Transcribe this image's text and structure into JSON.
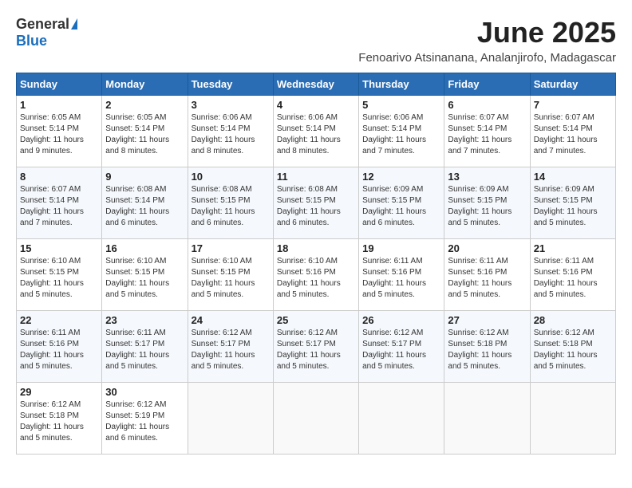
{
  "logo": {
    "general": "General",
    "blue": "Blue"
  },
  "title": "June 2025",
  "location": "Fenoarivo Atsinanana, Analanjirofo, Madagascar",
  "days_of_week": [
    "Sunday",
    "Monday",
    "Tuesday",
    "Wednesday",
    "Thursday",
    "Friday",
    "Saturday"
  ],
  "weeks": [
    [
      {
        "day": "1",
        "sunrise": "6:05 AM",
        "sunset": "5:14 PM",
        "daylight": "11 hours and 9 minutes."
      },
      {
        "day": "2",
        "sunrise": "6:05 AM",
        "sunset": "5:14 PM",
        "daylight": "11 hours and 8 minutes."
      },
      {
        "day": "3",
        "sunrise": "6:06 AM",
        "sunset": "5:14 PM",
        "daylight": "11 hours and 8 minutes."
      },
      {
        "day": "4",
        "sunrise": "6:06 AM",
        "sunset": "5:14 PM",
        "daylight": "11 hours and 8 minutes."
      },
      {
        "day": "5",
        "sunrise": "6:06 AM",
        "sunset": "5:14 PM",
        "daylight": "11 hours and 7 minutes."
      },
      {
        "day": "6",
        "sunrise": "6:07 AM",
        "sunset": "5:14 PM",
        "daylight": "11 hours and 7 minutes."
      },
      {
        "day": "7",
        "sunrise": "6:07 AM",
        "sunset": "5:14 PM",
        "daylight": "11 hours and 7 minutes."
      }
    ],
    [
      {
        "day": "8",
        "sunrise": "6:07 AM",
        "sunset": "5:14 PM",
        "daylight": "11 hours and 7 minutes."
      },
      {
        "day": "9",
        "sunrise": "6:08 AM",
        "sunset": "5:14 PM",
        "daylight": "11 hours and 6 minutes."
      },
      {
        "day": "10",
        "sunrise": "6:08 AM",
        "sunset": "5:15 PM",
        "daylight": "11 hours and 6 minutes."
      },
      {
        "day": "11",
        "sunrise": "6:08 AM",
        "sunset": "5:15 PM",
        "daylight": "11 hours and 6 minutes."
      },
      {
        "day": "12",
        "sunrise": "6:09 AM",
        "sunset": "5:15 PM",
        "daylight": "11 hours and 6 minutes."
      },
      {
        "day": "13",
        "sunrise": "6:09 AM",
        "sunset": "5:15 PM",
        "daylight": "11 hours and 5 minutes."
      },
      {
        "day": "14",
        "sunrise": "6:09 AM",
        "sunset": "5:15 PM",
        "daylight": "11 hours and 5 minutes."
      }
    ],
    [
      {
        "day": "15",
        "sunrise": "6:10 AM",
        "sunset": "5:15 PM",
        "daylight": "11 hours and 5 minutes."
      },
      {
        "day": "16",
        "sunrise": "6:10 AM",
        "sunset": "5:15 PM",
        "daylight": "11 hours and 5 minutes."
      },
      {
        "day": "17",
        "sunrise": "6:10 AM",
        "sunset": "5:15 PM",
        "daylight": "11 hours and 5 minutes."
      },
      {
        "day": "18",
        "sunrise": "6:10 AM",
        "sunset": "5:16 PM",
        "daylight": "11 hours and 5 minutes."
      },
      {
        "day": "19",
        "sunrise": "6:11 AM",
        "sunset": "5:16 PM",
        "daylight": "11 hours and 5 minutes."
      },
      {
        "day": "20",
        "sunrise": "6:11 AM",
        "sunset": "5:16 PM",
        "daylight": "11 hours and 5 minutes."
      },
      {
        "day": "21",
        "sunrise": "6:11 AM",
        "sunset": "5:16 PM",
        "daylight": "11 hours and 5 minutes."
      }
    ],
    [
      {
        "day": "22",
        "sunrise": "6:11 AM",
        "sunset": "5:16 PM",
        "daylight": "11 hours and 5 minutes."
      },
      {
        "day": "23",
        "sunrise": "6:11 AM",
        "sunset": "5:17 PM",
        "daylight": "11 hours and 5 minutes."
      },
      {
        "day": "24",
        "sunrise": "6:12 AM",
        "sunset": "5:17 PM",
        "daylight": "11 hours and 5 minutes."
      },
      {
        "day": "25",
        "sunrise": "6:12 AM",
        "sunset": "5:17 PM",
        "daylight": "11 hours and 5 minutes."
      },
      {
        "day": "26",
        "sunrise": "6:12 AM",
        "sunset": "5:17 PM",
        "daylight": "11 hours and 5 minutes."
      },
      {
        "day": "27",
        "sunrise": "6:12 AM",
        "sunset": "5:18 PM",
        "daylight": "11 hours and 5 minutes."
      },
      {
        "day": "28",
        "sunrise": "6:12 AM",
        "sunset": "5:18 PM",
        "daylight": "11 hours and 5 minutes."
      }
    ],
    [
      {
        "day": "29",
        "sunrise": "6:12 AM",
        "sunset": "5:18 PM",
        "daylight": "11 hours and 5 minutes."
      },
      {
        "day": "30",
        "sunrise": "6:12 AM",
        "sunset": "5:19 PM",
        "daylight": "11 hours and 6 minutes."
      },
      null,
      null,
      null,
      null,
      null
    ]
  ]
}
